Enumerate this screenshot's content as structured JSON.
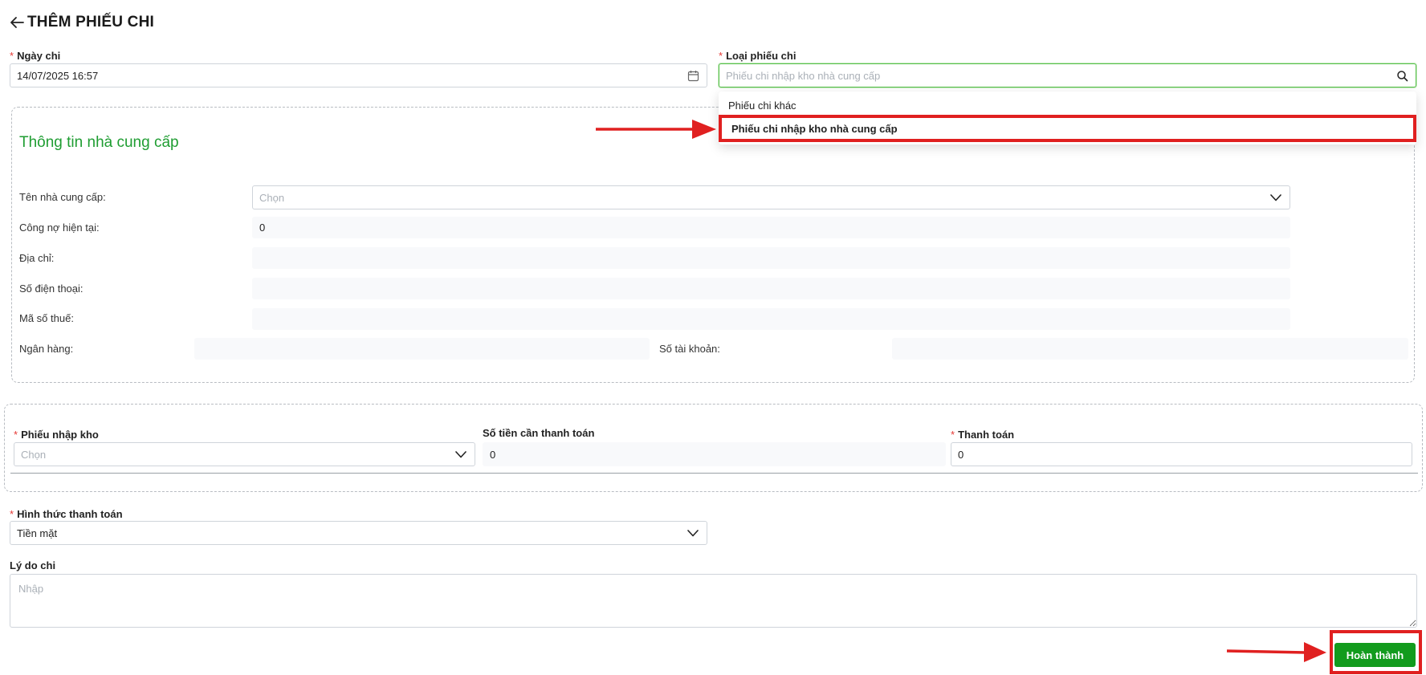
{
  "header": {
    "title": "THÊM PHIẾU CHI"
  },
  "form": {
    "ngay_chi": {
      "label": "Ngày chi",
      "value": "14/07/2025 16:57"
    },
    "loai_phieu_chi": {
      "label": "Loại phiếu chi",
      "placeholder": "Phiếu chi nhập kho nhà cung cấp",
      "options": [
        "Phiếu chi khác",
        "Phiếu chi nhập kho nhà cung cấp"
      ],
      "highlighted_option": "Phiếu chi nhập kho nhà cung cấp"
    },
    "supplier": {
      "section_title": "Thông tin nhà cung cấp",
      "ten_label": "Tên nhà cung cấp:",
      "ten_placeholder": "Chọn",
      "cong_no_label": "Công nợ hiện tại:",
      "cong_no_value": "0",
      "dia_chi_label": "Địa chỉ:",
      "sdt_label": "Số điện thoại:",
      "mst_label": "Mã số thuế:",
      "ngan_hang_label": "Ngân hàng:",
      "so_tai_khoan_label": "Số tài khoản:"
    },
    "receipt": {
      "phieu_nhap_kho_label": "Phiếu nhập kho",
      "phieu_nhap_kho_placeholder": "Chọn",
      "so_tien_label": "Số tiền cần thanh toán",
      "so_tien_value": "0",
      "thanh_toan_label": "Thanh toán",
      "thanh_toan_value": "0"
    },
    "hinh_thuc": {
      "label": "Hình thức thanh toán",
      "value": "Tiền mặt"
    },
    "ly_do": {
      "label": "Lý do chi",
      "placeholder": "Nhập"
    }
  },
  "actions": {
    "done_label": "Hoàn thành"
  },
  "colors": {
    "accent_green": "#129b1d",
    "section_green": "#1f9d32",
    "annotation_red": "#e02020",
    "required_red": "#e53935"
  },
  "icons": [
    "back-arrow-icon",
    "calendar-icon",
    "search-icon",
    "chevron-down-icon",
    "resize-handle-icon"
  ]
}
